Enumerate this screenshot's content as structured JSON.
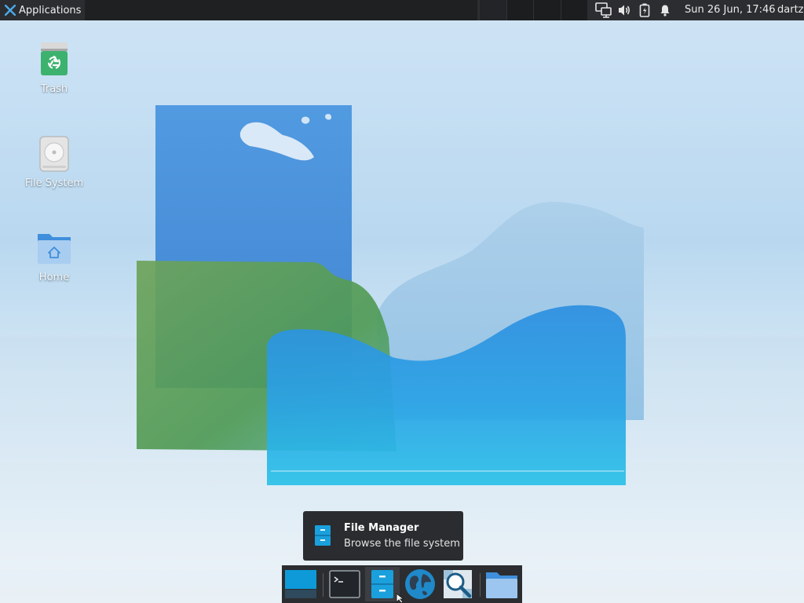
{
  "panel": {
    "applications_label": "Applications",
    "clock": "Sun 26 Jun, 17:46",
    "user": "dartz"
  },
  "tray": {
    "icons": [
      "network-icon",
      "volume-icon",
      "battery-icon",
      "notification-bell-icon"
    ]
  },
  "desktop": {
    "icons": [
      {
        "label": "Trash",
        "icon": "trash-icon"
      },
      {
        "label": "File System",
        "icon": "drive-icon"
      },
      {
        "label": "Home",
        "icon": "home-folder-icon"
      }
    ]
  },
  "tooltip": {
    "title": "File Manager",
    "subtitle": "Browse the file system"
  },
  "dock": {
    "items": [
      "show-desktop",
      "terminal",
      "file-manager",
      "web-browser",
      "app-finder",
      "folder"
    ],
    "active": "file-manager"
  },
  "colors": {
    "panel": "#2b2d30",
    "accent": "#1aa0dc",
    "trash_green": "#3cb26e",
    "folder_blue": "#3f8fdc"
  }
}
